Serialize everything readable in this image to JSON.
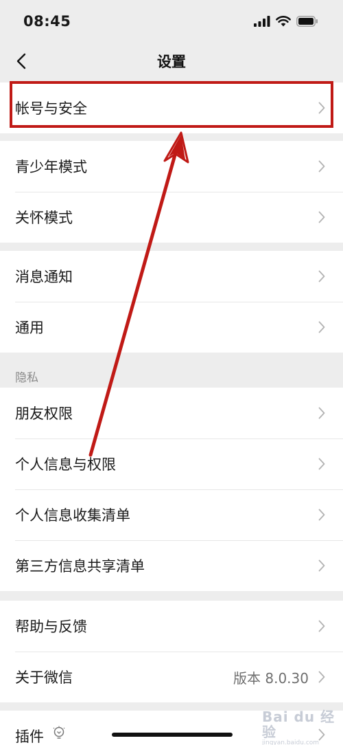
{
  "status_bar": {
    "time": "08:45"
  },
  "nav": {
    "title": "设置"
  },
  "groups": {
    "account": {
      "items": [
        "帐号与安全"
      ]
    },
    "modes": {
      "items": [
        "青少年模式",
        "关怀模式"
      ]
    },
    "general": {
      "items": [
        "消息通知",
        "通用"
      ]
    },
    "privacy": {
      "title": "隐私",
      "items": [
        "朋友权限",
        "个人信息与权限",
        "个人信息收集清单",
        "第三方信息共享清单"
      ]
    },
    "help": {
      "items": [
        "帮助与反馈",
        "关于微信"
      ],
      "about_value": "版本 8.0.30"
    },
    "plugins": {
      "items": [
        "插件"
      ]
    }
  },
  "watermark": {
    "text": "Bai du 经验",
    "sub": "jingyan.baidu.com"
  },
  "colors": {
    "highlight": "#c01a16",
    "background": "#ededed",
    "text": "#181818",
    "secondary": "#8a8a8a"
  }
}
